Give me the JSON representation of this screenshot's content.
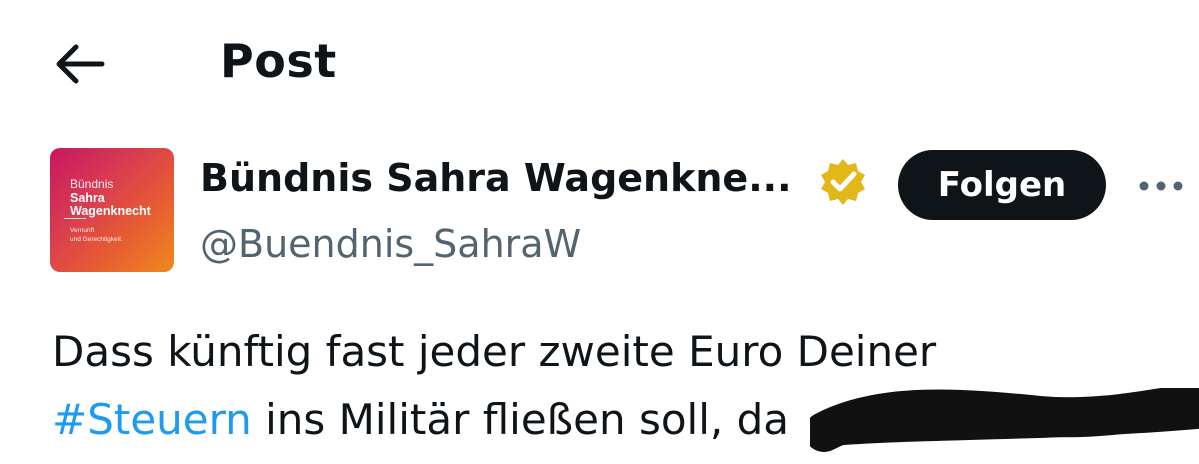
{
  "header": {
    "title": "Post",
    "back_icon": "arrow-left-icon"
  },
  "author": {
    "display_name": "Bündnis Sahra Wagenkne...",
    "handle": "@Buendnis_SahraW",
    "verified_icon": "verified-badge-icon",
    "verified_color": "#e2b719",
    "follow_label": "Folgen",
    "more_icon": "more-horizontal-icon",
    "avatar": {
      "line1": "Bündnis",
      "line2": "Sahra",
      "line3": "Wagenknecht",
      "line4": "Vernunft",
      "line5": "und Gerechtigkeit."
    }
  },
  "post": {
    "line1": "Dass künftig fast jeder zweite Euro Deiner",
    "hashtag": "#Steuern",
    "line2_rest": " ins Militär fließen soll, da",
    "hashtag_color": "#1d9bf0"
  }
}
